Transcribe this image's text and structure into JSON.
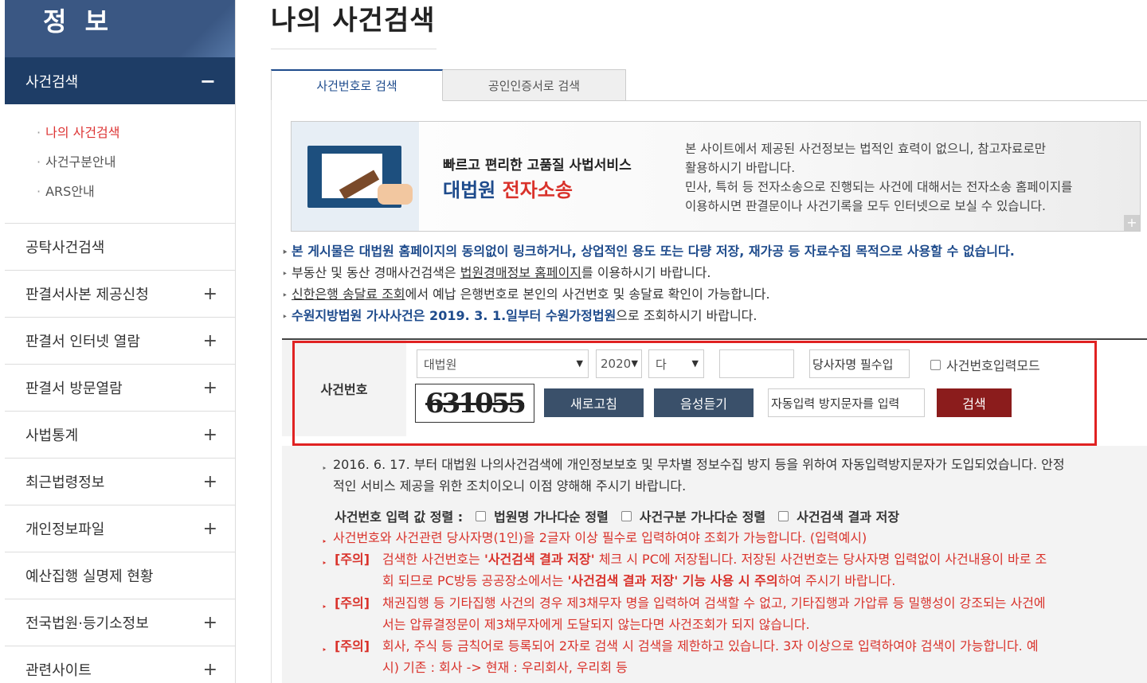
{
  "sidebar": {
    "title": "정 보",
    "active": {
      "label": "사건검색",
      "toggle": "−"
    },
    "subitems": [
      {
        "label": "나의 사건검색"
      },
      {
        "label": "사건구분안내"
      },
      {
        "label": "ARS안내"
      }
    ],
    "items": [
      {
        "label": "공탁사건검색",
        "toggle": ""
      },
      {
        "label": "판결서사본 제공신청",
        "toggle": "+"
      },
      {
        "label": "판결서 인터넷 열람",
        "toggle": "+"
      },
      {
        "label": "판결서 방문열람",
        "toggle": "+"
      },
      {
        "label": "사법통계",
        "toggle": "+"
      },
      {
        "label": "최근법령정보",
        "toggle": "+"
      },
      {
        "label": "개인정보파일",
        "toggle": "+"
      },
      {
        "label": "예산집행 실명제 현황",
        "toggle": ""
      },
      {
        "label": "전국법원·등기소정보",
        "toggle": "+"
      },
      {
        "label": "관련사이트",
        "toggle": "+"
      }
    ]
  },
  "main": {
    "title": "나의 사건검색",
    "tabs": [
      {
        "label": "사건번호로 검색"
      },
      {
        "label": "공인인증서로 검색"
      }
    ]
  },
  "banner": {
    "slogan": "빠르고 편리한 고품질 사법서비스",
    "brand_a": "대법원",
    "brand_b": "전자소송",
    "notice_1": "본 사이트에서 제공된 사건정보는 법적인 효력이 없으니, 참고자료로만",
    "notice_2": "활용하시기 바랍니다.",
    "notice_3": "민사, 특허 등 전자소송으로 진행되는 사건에 대해서는 전자소송 홈페이지를",
    "notice_4": "이용하시면 판결문이나 사건기록을 모두 인터넷으로 보실 수 있습니다.",
    "more": "+"
  },
  "notes": {
    "n1": "본 게시물은 대법원 홈페이지의 동의없이 링크하거나, 상업적인 용도 또는 다량 저장, 재가공 등 자료수집 목적으로 사용할 수 없습니다.",
    "n2_a": "부동산 및 동산 경매사건검색은 ",
    "n2_link": "법원경매정보 홈페이지",
    "n2_b": "를 이용하시기 바랍니다.",
    "n3_link": "신한은행 송달료 조회",
    "n3_b": "에서 예납 은행번호로 본인의 사건번호 및 송달료 확인이 가능합니다.",
    "n4_a": "수원지방법원 가사사건은 2019. 3. 1.일부터 수원가정법원",
    "n4_b": "으로 조회하시기 바랍니다."
  },
  "search": {
    "label": "사건번호",
    "court": "대법원",
    "year": "2020",
    "case_type": "다",
    "case_number": "",
    "party_placeholder": "당사자명 필수입",
    "mode_label": "사건번호입력모드",
    "captcha_text": "631055",
    "refresh_label": "새로고침",
    "audio_label": "음성듣기",
    "captcha_placeholder": "자동입력 방지문자를 입력",
    "search_label": "검색"
  },
  "info": {
    "p1_a": "2016. 6. 17. 부터 대법원 나의사건검색에 개인정보보호 및 무차별 정보수집 방지 등을 위하여 자동입력방지문자가 도입되었습니다. 안정",
    "p1_b": "적인 서비스 제공을 위한 조치이오니 이점 양해해 주시기 바랍니다.",
    "sort_label": "사건번호 입력 값 정렬 :",
    "sort_opt1": "법원명 가나다순 정렬",
    "sort_opt2": "사건구분 가나다순 정렬",
    "sort_opt3": "사건검색 결과 저장",
    "p2": "사건번호와 사건관련 당사자명(1인)을 2글자 이상 필수로 입력하여야 조회가 가능합니다. (입력예시)",
    "tag": "[주의]",
    "w1_a": "검색한 사건번호는 ",
    "w1_b": "'사건검색 결과 저장'",
    "w1_c": " 체크 시 PC에 저장됩니다. 저장된 사건번호는 당사자명 입력없이 사건내용이 바로 조",
    "w1_d": "회 되므로 PC방등 공공장소에서는 ",
    "w1_e": "'사건검색 결과 저장' 기능 사용 시 주의",
    "w1_f": "하여 주시기 바랍니다.",
    "w2_a": "채권집행 등 기타집행 사건의 경우 제3채무자 명을 입력하여 검색할 수 없고, 기타집행과 가압류 등 밀행성이 강조되는 사건에",
    "w2_b": "서는 압류결정문이 제3채무자에게 도달되지 않는다면 사건조회가 되지 않습니다.",
    "w3_a": "회사, 주식 등 금칙어로 등록되어 2자로 검색 시 검색을 제한하고 있습니다. 3자 이상으로 입력하여야 검색이 가능합니다. 예",
    "w3_b": "시) 기존 : 회사 -> 현재 : 우리회사, 우리회 등"
  }
}
